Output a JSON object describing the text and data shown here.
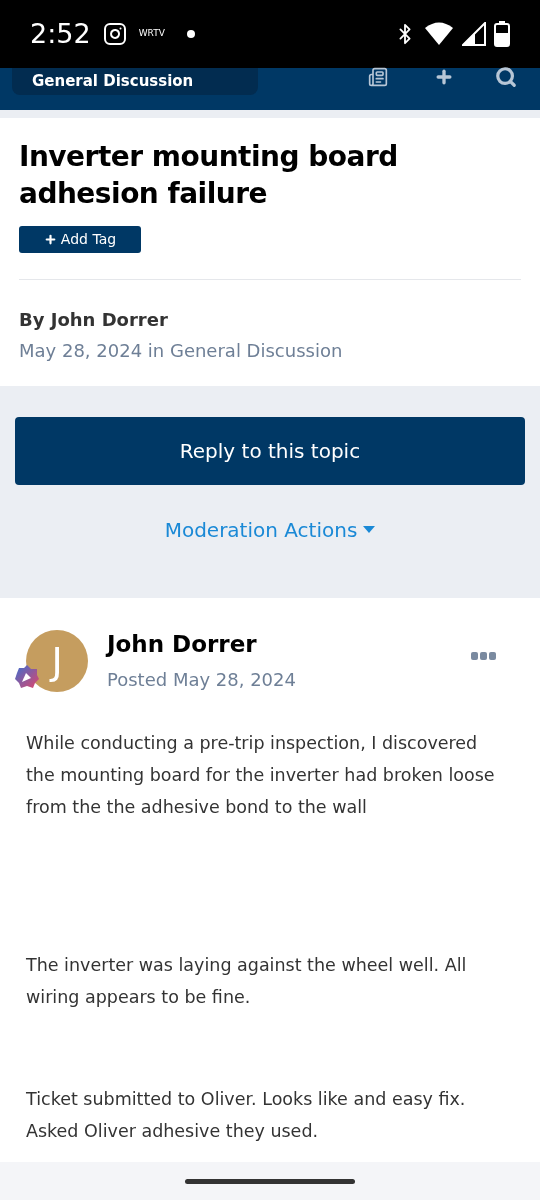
{
  "status_bar": {
    "time": "2:52",
    "notification_label": "WRTV"
  },
  "header": {
    "breadcrumb": "General Discussion"
  },
  "topic": {
    "title": "Inverter mounting board adhesion failure",
    "add_tag": "Add Tag",
    "author": "By John Dorrer",
    "meta": "May 28, 2024 in General Discussion"
  },
  "actions": {
    "reply": "Reply to this topic",
    "moderation": "Moderation Actions"
  },
  "post": {
    "avatar_letter": "J",
    "author": "John Dorrer",
    "posted": "Posted May 28, 2024",
    "paragraphs": [
      "While conducting a pre-trip inspection, I discovered the mounting board for the inverter had broken loose from the the adhesive bond to the wall",
      "The inverter was laying against the wheel well. All wiring appears to be fine.",
      "Ticket submitted to Oliver. Looks like and easy fix. Asked Oliver adhesive they used."
    ]
  }
}
